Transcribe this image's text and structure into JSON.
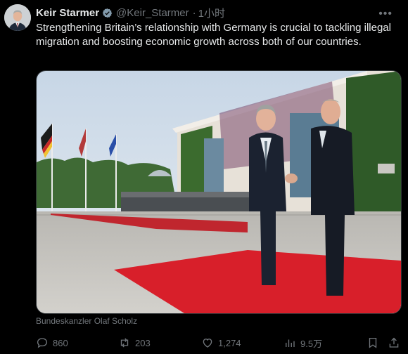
{
  "author": {
    "name": "Keir Starmer",
    "handle": "@Keir_Starmer",
    "time": "1小时"
  },
  "tweet": {
    "text": "Strengthening Britain’s relationship with Germany is crucial to tackling illegal migration and boosting economic growth across both of our countries."
  },
  "media": {
    "caption": "Bundeskanzler Olaf Scholz"
  },
  "actions": {
    "replies": "860",
    "reposts": "203",
    "likes": "1,274",
    "views": "9.5万"
  },
  "icons": {
    "verified": "verified-badge-icon",
    "more": "more-icon",
    "reply": "reply-icon",
    "repost": "repost-icon",
    "like": "heart-icon",
    "views": "views-icon",
    "bookmark": "bookmark-icon",
    "share": "share-icon"
  },
  "colors": {
    "background": "#000000",
    "text": "#e7e9ea",
    "muted": "#71767b",
    "verified": "#829aab",
    "red_carpet": "#d81f2a"
  }
}
